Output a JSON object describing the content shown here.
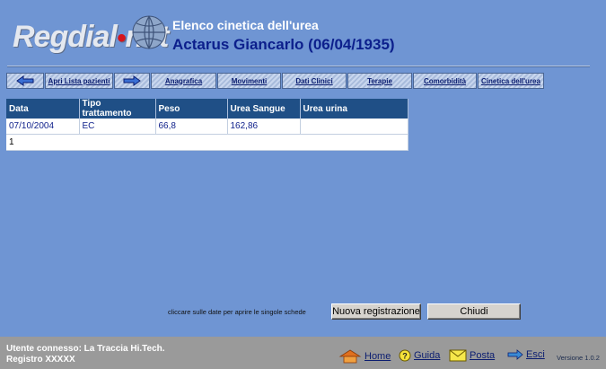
{
  "header": {
    "logo_text_main": "Regdial",
    "logo_text_net": "net",
    "title": "Elenco cinetica dell'urea",
    "patient": "Actarus Giancarlo (06/04/1935)"
  },
  "nav": [
    {
      "type": "icon",
      "icon": "arrow-left-icon"
    },
    {
      "type": "text",
      "label": "Apri Lista pazienti"
    },
    {
      "type": "icon",
      "icon": "arrow-right-icon"
    },
    {
      "type": "text",
      "label": "Anagrafica"
    },
    {
      "type": "text",
      "label": "Movimenti"
    },
    {
      "type": "text",
      "label": "Dati Clinici"
    },
    {
      "type": "text",
      "label": "Terapie"
    },
    {
      "type": "text",
      "label": "Comorbidità"
    },
    {
      "type": "text",
      "label": "Cinetica dell'urea"
    }
  ],
  "table": {
    "columns": [
      "Data",
      "Tipo trattamento",
      "Peso",
      "Urea Sangue",
      "Urea urina"
    ],
    "rows": [
      [
        "07/10/2004",
        "EC",
        "66,8",
        "162,86",
        ""
      ]
    ],
    "pagination": "1"
  },
  "actions": {
    "hint": "cliccare sulle date per aprire le singole schede",
    "new_label": "Nuova registrazione",
    "close_label": "Chiudi"
  },
  "footer": {
    "user_line": "Utente connesso: La Traccia Hi.Tech.",
    "registry_line": "Registro XXXXX",
    "home": "Home",
    "help": "Guida",
    "mail": "Posta",
    "exit": "Esci",
    "version": "Versione 1.0.2"
  },
  "colors": {
    "background": "#6f95d3",
    "table_header": "#1f4f86",
    "patient_text": "#0c1f8c",
    "footer": "#9a9a9a",
    "logo_dot": "#d6141b"
  }
}
